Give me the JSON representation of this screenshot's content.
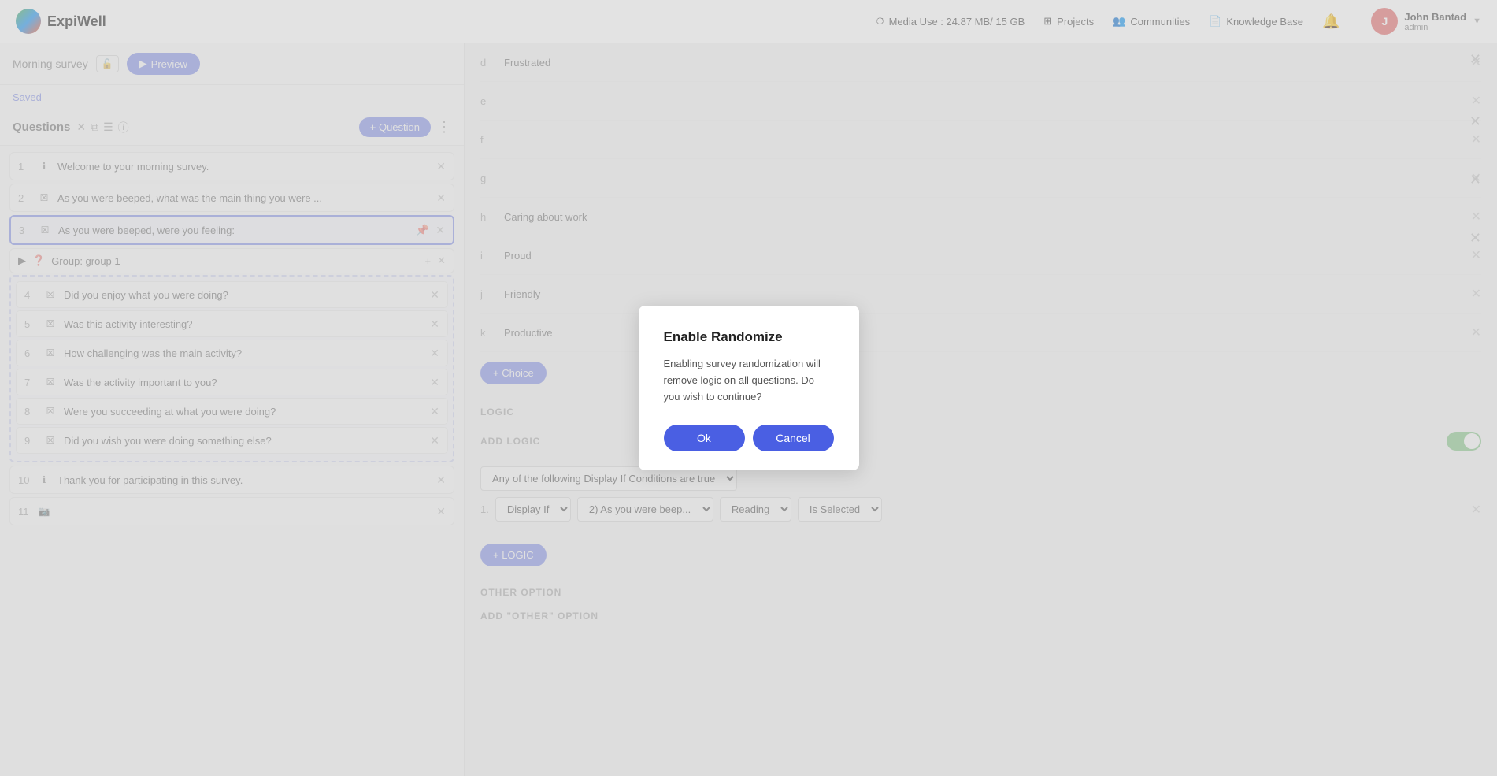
{
  "app": {
    "name": "ExpiWell"
  },
  "nav": {
    "media_use": "Media Use : 24.87 MB/ 15 GB",
    "projects": "Projects",
    "communities": "Communities",
    "knowledge_base": "Knowledge Base",
    "user_name": "John Bantad",
    "user_role": "admin"
  },
  "survey": {
    "title": "Morning survey",
    "saved_text": "Saved",
    "preview_label": "Preview"
  },
  "questions_panel": {
    "title": "Questions",
    "add_question_label": "+ Question"
  },
  "questions": [
    {
      "num": "1",
      "type": "info",
      "text": "Welcome to your morning survey."
    },
    {
      "num": "2",
      "type": "checkbox",
      "text": "As you were beeped, what was the main thing you were ..."
    },
    {
      "num": "3",
      "type": "checkbox",
      "text": "As you were beeped, were you feeling:",
      "active": true
    }
  ],
  "group": {
    "label": "Group: group 1",
    "items": [
      {
        "num": "4",
        "text": "Did you enjoy what you were doing?"
      },
      {
        "num": "5",
        "text": "Was this activity interesting?"
      },
      {
        "num": "6",
        "text": "How challenging was the main activity?"
      },
      {
        "num": "7",
        "text": "Was the activity important to you?"
      },
      {
        "num": "8",
        "text": "Were you succeeding at what you were doing?"
      },
      {
        "num": "9",
        "text": "Did you wish you were doing something else?"
      }
    ]
  },
  "bottom_questions": [
    {
      "num": "10",
      "type": "info",
      "text": "Thank you for participating in this survey."
    },
    {
      "num": "11",
      "type": "camera",
      "text": ""
    }
  ],
  "choices": [
    {
      "label": "d",
      "text": "Frustrated"
    },
    {
      "label": "e",
      "text": ""
    },
    {
      "label": "f",
      "text": ""
    },
    {
      "label": "g",
      "text": ""
    },
    {
      "label": "h",
      "text": "Caring about work"
    },
    {
      "label": "i",
      "text": "Proud"
    },
    {
      "label": "j",
      "text": "Friendly"
    },
    {
      "label": "k",
      "text": "Productive"
    }
  ],
  "add_choice_label": "+ Choice",
  "logic": {
    "section_title": "LOGIC",
    "add_logic_label": "ADD LOGIC",
    "condition_dropdown": "Any of the following Display If Conditions are true",
    "condition_row": {
      "num": "1.",
      "display_if": "Display If",
      "question": "2) As you were beep...",
      "value": "Reading",
      "operator": "Is Selected"
    },
    "add_logic_btn": "+ LOGIC"
  },
  "other_option": {
    "section_title": "OTHER OPTION",
    "add_other_label": "ADD \"OTHER\" OPTION"
  },
  "modal": {
    "title": "Enable Randomize",
    "body": "Enabling survey randomization will remove logic on all questions. Do you wish to continue?",
    "ok_label": "Ok",
    "cancel_label": "Cancel"
  }
}
